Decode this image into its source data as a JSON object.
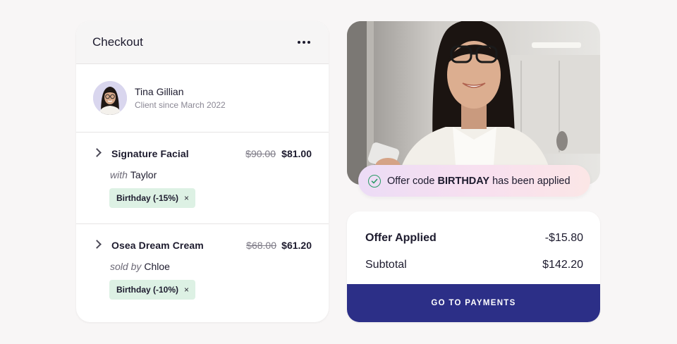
{
  "checkout": {
    "title": "Checkout",
    "more_icon": "more-horizontal-icon",
    "client": {
      "name": "Tina Gillian",
      "since": "Client since March 2022"
    },
    "items": [
      {
        "name": "Signature Facial",
        "old_price": "$90.00",
        "new_price": "$81.00",
        "staff_prefix": "with",
        "staff_name": "Taylor",
        "discount": "Birthday (-15%)",
        "remove_symbol": "×"
      },
      {
        "name": "Osea Dream Cream",
        "old_price": "$68.00",
        "new_price": "$61.20",
        "staff_prefix": "sold by",
        "staff_name": "Chloe",
        "discount": "Birthday (-10%)",
        "remove_symbol": "×"
      }
    ]
  },
  "toast": {
    "prefix": "Offer code",
    "code": "BIRTHDAY",
    "suffix": "has been applied",
    "icon": "check-circle-icon",
    "icon_color": "#2a9b67"
  },
  "summary": {
    "offer_label": "Offer Applied",
    "offer_value": "-$15.80",
    "subtotal_label": "Subtotal",
    "subtotal_value": "$142.20",
    "pay_button": "GO TO PAYMENTS"
  },
  "colors": {
    "accent": "#2c2f87",
    "chip_bg": "#ddf1e4",
    "page_bg": "#f8f6f6"
  }
}
